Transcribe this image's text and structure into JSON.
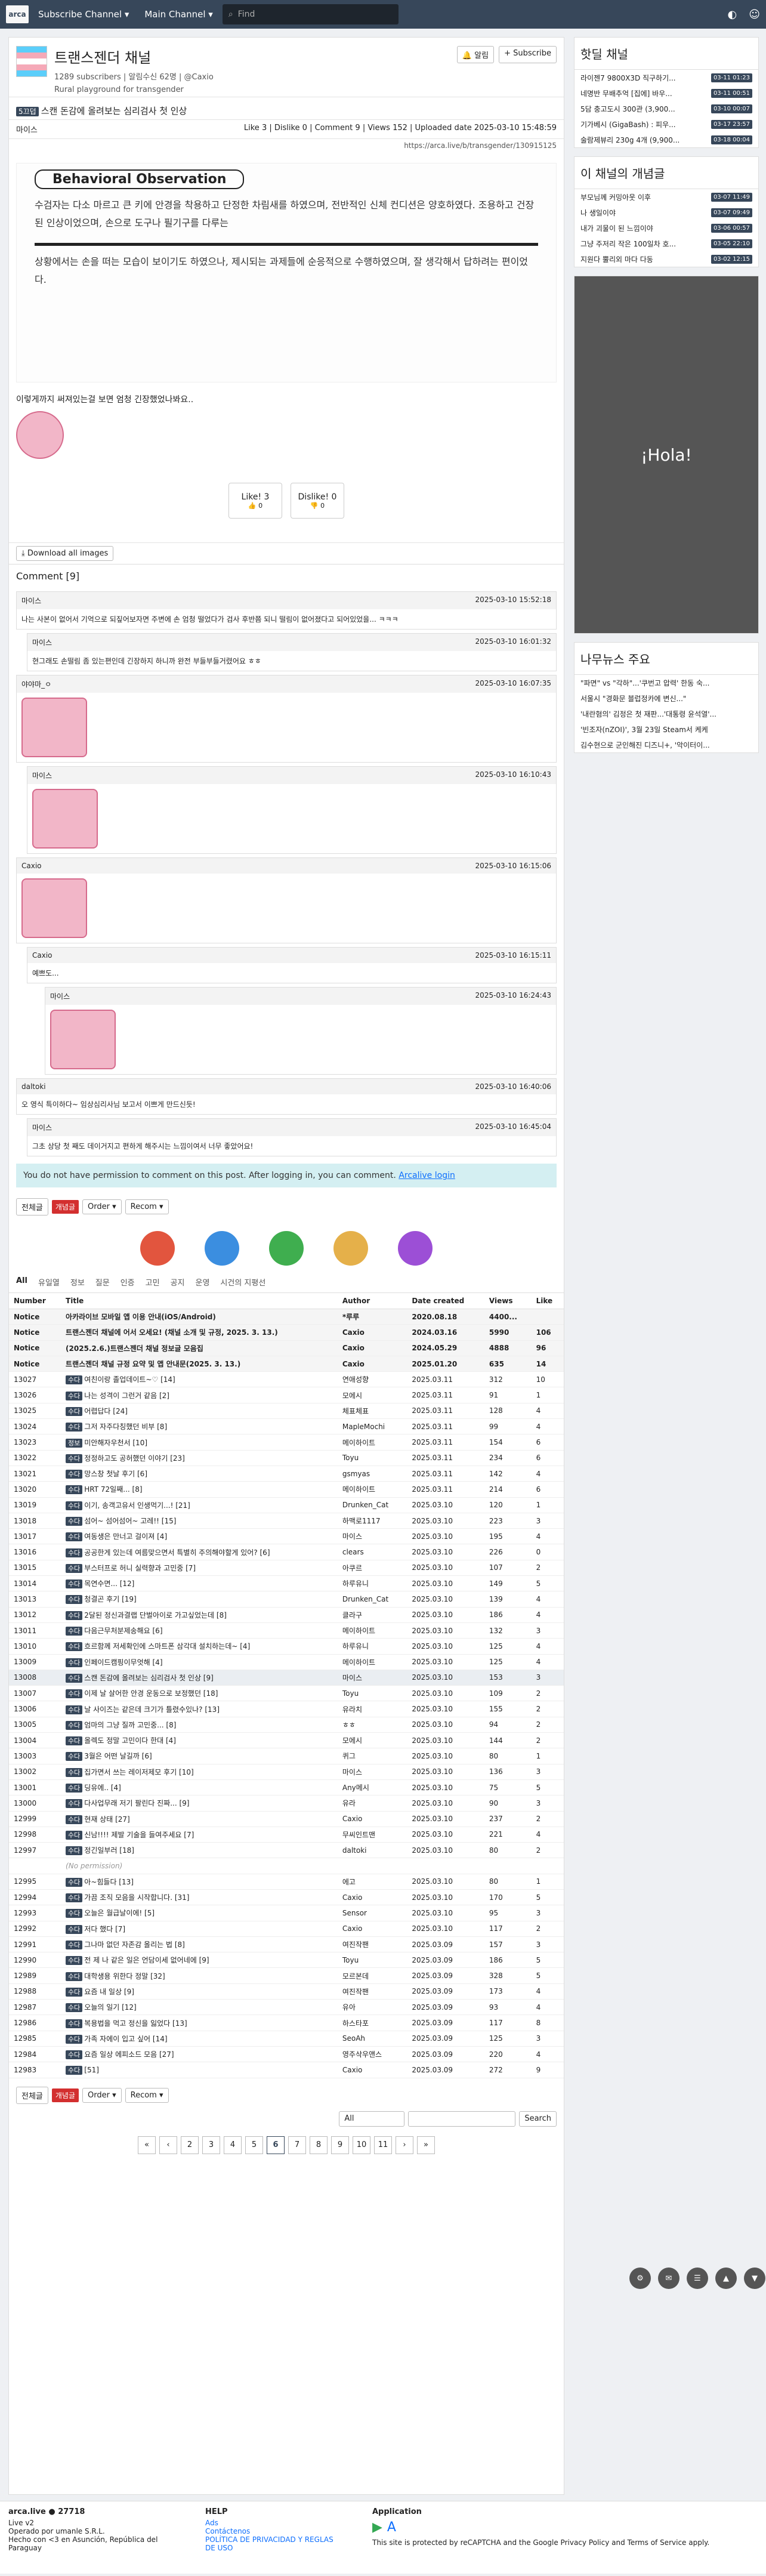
{
  "nav": {
    "subscribe": "Subscribe Channel ▾",
    "main": "Main Channel ▾",
    "search_placeholder": "Find"
  },
  "channel": {
    "title": "트랜스젠더 채널",
    "meta": "1289 subscribers | 알림수신 62명 | @Caxio",
    "desc": "Rural playground for transgender",
    "alarm": "알림",
    "subscribe": "+ Subscribe"
  },
  "post": {
    "tag": "5끄덥",
    "title": "스캔 돈감에 올려보는 심리검사 첫 인상",
    "author": "마이스",
    "stats": "Like 3 | Dislike 0 | Comment 9 | Views 152 | Uploaded date 2025-03-10 15:48:59",
    "url": "https://arca.live/b/transgender/130915125",
    "img_title": "Behavioral Observation",
    "img_p1": "수검자는 다소 마르고 큰 키에 안경을 착용하고 단정한 차림새를 하였으며, 전반적인 신체 컨디션은 양호하였다. 조용하고 건장된 인상이었으며, 손으로 도구나 필기구를 다루는",
    "img_p2": "상황에서는 손을 떠는 모습이 보이기도 하였으나, 제시되는 과제들에 순응적으로 수행하였으며, 잘 생각해서 답하려는 편이었다.",
    "body": "이렇게까지 써져있는걸 보면 엄청 긴장했었나봐요..",
    "like": "Like! 3",
    "like_sub": "0",
    "dislike": "Dislike! 0",
    "dislike_sub": "0",
    "download": "Download all images"
  },
  "comments": {
    "header": "Comment [9]",
    "items": [
      {
        "author": "마이스",
        "date": "2025-03-10 15:52:18",
        "text": "나는 사본이 없어서 기억으로 되짚어보자면 주변에 손 엄청 떨었다가 검사 후반쯤 되니 떨림이 없어졌다고 되어있었을... ㅋㅋㅋ"
      },
      {
        "author": "마이스",
        "date": "2025-03-10 16:01:32",
        "text": "현그래도 손떨림 좀 있는편인데 긴장하지 하니까 완전 부들부들거렸어요 ㅎㅎ"
      },
      {
        "author": "야야마_ㅇ",
        "date": "2025-03-10 16:07:35",
        "text": ""
      },
      {
        "author": "마이스",
        "date": "2025-03-10 16:10:43",
        "text": ""
      },
      {
        "author": "Caxio",
        "date": "2025-03-10 16:15:06",
        "text": ""
      },
      {
        "author": "Caxio",
        "date": "2025-03-10 16:15:11",
        "text": "예쁘도..."
      },
      {
        "author": "마이스",
        "date": "2025-03-10 16:24:43",
        "text": ""
      },
      {
        "author": "daltoki",
        "date": "2025-03-10 16:40:06",
        "text": "오 영식 특이하다~ 임상심리사님 보고서 이쁘게 만드신듯!"
      },
      {
        "author": "마이스",
        "date": "2025-03-10 16:45:04",
        "text": "그초 상당 첫 째도 데이거지고 편하게 해주시는 느낌이여서 너무 좋았어요!"
      }
    ]
  },
  "login_notice": "You do not have permission to comment on this post. After logging in, you can comment.",
  "login_link": "Arcalive login",
  "filters": {
    "all": "전체글",
    "hot": "개념글",
    "order": "Order ▾",
    "recom": "Recom ▾"
  },
  "tabs": [
    "All",
    "유일열",
    "정보",
    "질문",
    "인증",
    "고민",
    "공지",
    "운영",
    "시건의 지평선"
  ],
  "table": {
    "headers": [
      "Number",
      "Title",
      "Author",
      "Date created",
      "Views",
      "Like"
    ],
    "notices": [
      {
        "n": "Notice",
        "t": "아카라이브 모바일 앱 이용 안내(iOS/Android)",
        "a": "*루루",
        "d": "2020.08.18",
        "v": "4400...",
        "l": ""
      },
      {
        "n": "Notice",
        "t": "트랜스젠더 채널에 어서 오세요! (채널 소개 및 규정, 2025. 3. 13.)",
        "a": "Caxio",
        "d": "2024.03.16",
        "v": "5990",
        "l": "106"
      },
      {
        "n": "Notice",
        "t": "(2025.2.6.)트랜스젠더 채널 정보글 모음집",
        "a": "Caxio",
        "d": "2024.05.29",
        "v": "4888",
        "l": "96"
      },
      {
        "n": "Notice",
        "t": "트랜스젠더 채널 규정 요약 및 앱 안내문(2025. 3. 13.)",
        "a": "Caxio",
        "d": "2025.01.20",
        "v": "635",
        "l": "14"
      }
    ],
    "rows": [
      {
        "n": "13027",
        "c": "수다",
        "t": "여친이랑 졸업데이트~♡ [14]",
        "a": "연애성향",
        "d": "2025.03.11",
        "v": "312",
        "l": "10"
      },
      {
        "n": "13026",
        "c": "수다",
        "t": "나는 성격이 그런거 같음 [2]",
        "a": "모에시",
        "d": "2025.03.11",
        "v": "91",
        "l": "1"
      },
      {
        "n": "13025",
        "c": "수다",
        "t": "어렵답다 [24]",
        "a": "체표체표",
        "d": "2025.03.11",
        "v": "128",
        "l": "4"
      },
      {
        "n": "13024",
        "c": "수다",
        "t": "그저 자주다칭했던 비부 [8]",
        "a": "MapleMochi",
        "d": "2025.03.11",
        "v": "99",
        "l": "4"
      },
      {
        "n": "13023",
        "c": "정보",
        "t": "미안해자우천서 [10]",
        "a": "메이하이트",
        "d": "2025.03.11",
        "v": "154",
        "l": "6"
      },
      {
        "n": "13022",
        "c": "수다",
        "t": "정정하고도 공허했던 이야기 [23]",
        "a": "Toyu",
        "d": "2025.03.11",
        "v": "234",
        "l": "6"
      },
      {
        "n": "13021",
        "c": "수다",
        "t": "망스창 첫날 후기 [6]",
        "a": "gsmyas",
        "d": "2025.03.11",
        "v": "142",
        "l": "4"
      },
      {
        "n": "13020",
        "c": "수다",
        "t": "HRT 72일째... [8]",
        "a": "메이하이트",
        "d": "2025.03.11",
        "v": "214",
        "l": "6"
      },
      {
        "n": "13019",
        "c": "수다",
        "t": "이기, 송객고유서 인생먹기...! [21]",
        "a": "Drunken_Cat",
        "d": "2025.03.10",
        "v": "120",
        "l": "1"
      },
      {
        "n": "13018",
        "c": "수다",
        "t": "섬어~ 섬어섬어~ 고레!! [15]",
        "a": "하맥로1117",
        "d": "2025.03.10",
        "v": "223",
        "l": "3"
      },
      {
        "n": "13017",
        "c": "수다",
        "t": "여동생은 만너고 걸이져 [4]",
        "a": "마이스",
        "d": "2025.03.10",
        "v": "195",
        "l": "4"
      },
      {
        "n": "13016",
        "c": "수다",
        "t": "공공한게 있는데 여름맞으면서 특별히 주의해야할게 있어? [6]",
        "a": "clears",
        "d": "2025.03.10",
        "v": "226",
        "l": "0"
      },
      {
        "n": "13015",
        "c": "수다",
        "t": "부스터프로 허니 실력향과 고민중 [7]",
        "a": "아쿠르",
        "d": "2025.03.10",
        "v": "107",
        "l": "2"
      },
      {
        "n": "13014",
        "c": "수다",
        "t": "목연수면... [12]",
        "a": "하루유니",
        "d": "2025.03.10",
        "v": "149",
        "l": "5"
      },
      {
        "n": "13013",
        "c": "수다",
        "t": "청결곤 후기 [19]",
        "a": "Drunken_Cat",
        "d": "2025.03.10",
        "v": "139",
        "l": "4"
      },
      {
        "n": "13012",
        "c": "수다",
        "t": "2달된 정신과결랩 단벌아이로 가고싶었는데 [8]",
        "a": "클라구",
        "d": "2025.03.10",
        "v": "186",
        "l": "4"
      },
      {
        "n": "13011",
        "c": "수다",
        "t": "다음근무처분제송해요 [6]",
        "a": "메이하이트",
        "d": "2025.03.10",
        "v": "132",
        "l": "3"
      },
      {
        "n": "13010",
        "c": "수다",
        "t": "흐르함께 저세확인에 스마트폰 삼각대 설치하는데~ [4]",
        "a": "하루유니",
        "d": "2025.03.10",
        "v": "125",
        "l": "4"
      },
      {
        "n": "13009",
        "c": "수다",
        "t": "인페이드캠핑이무엇해 [4]",
        "a": "메이하이트",
        "d": "2025.03.10",
        "v": "125",
        "l": "4"
      },
      {
        "n": "13008",
        "c": "수다",
        "t": "스캔 돈감에 올려보는 심리검사 첫 인상 [9]",
        "a": "마이스",
        "d": "2025.03.10",
        "v": "153",
        "l": "3"
      },
      {
        "n": "13007",
        "c": "수다",
        "t": "이제 날 살어한 안경 운동으로 보정했던 [18]",
        "a": "Toyu",
        "d": "2025.03.10",
        "v": "109",
        "l": "2"
      },
      {
        "n": "13006",
        "c": "수다",
        "t": "날 사이즈는 같은데 크기가 틀렸수있나? [13]",
        "a": "유라치",
        "d": "2025.03.10",
        "v": "155",
        "l": "2"
      },
      {
        "n": "13005",
        "c": "수다",
        "t": "엄마의 그냥 질까 고민중... [8]",
        "a": "ㅎㅎ",
        "d": "2025.03.10",
        "v": "94",
        "l": "2"
      },
      {
        "n": "13004",
        "c": "수다",
        "t": "올렉도 정말 고민이다 한대 [4]",
        "a": "모에시",
        "d": "2025.03.10",
        "v": "144",
        "l": "2"
      },
      {
        "n": "13003",
        "c": "수다",
        "t": "3월은 어떤 날길까 [6]",
        "a": "퀴그",
        "d": "2025.03.10",
        "v": "80",
        "l": "1"
      },
      {
        "n": "13002",
        "c": "수다",
        "t": "집가면서 쓰는 레이저제모 후기 [10]",
        "a": "마이스",
        "d": "2025.03.10",
        "v": "136",
        "l": "3"
      },
      {
        "n": "13001",
        "c": "수다",
        "t": "딩유에.. [4]",
        "a": "Any메시",
        "d": "2025.03.10",
        "v": "75",
        "l": "5"
      },
      {
        "n": "13000",
        "c": "수다",
        "t": "다사업무래 저기 팔린다 진짜... [9]",
        "a": "유라",
        "d": "2025.03.10",
        "v": "90",
        "l": "3"
      },
      {
        "n": "12999",
        "c": "수다",
        "t": "현재 상태 [27]",
        "a": "Caxio",
        "d": "2025.03.10",
        "v": "237",
        "l": "2"
      },
      {
        "n": "12998",
        "c": "수다",
        "t": "신남!!!! 제발 기술을 들여주세요 [7]",
        "a": "무씨인트맨",
        "d": "2025.03.10",
        "v": "221",
        "l": "4"
      },
      {
        "n": "12997",
        "c": "수다",
        "t": "정긴일부러 [18]",
        "a": "daltoki",
        "d": "2025.03.10",
        "v": "80",
        "l": "2"
      },
      {
        "n": "",
        "c": "",
        "t": "(No permission)",
        "a": "",
        "d": "",
        "v": "",
        "l": ""
      },
      {
        "n": "12995",
        "c": "수다",
        "t": "아~힘들다 [13]",
        "a": "에고",
        "d": "2025.03.10",
        "v": "80",
        "l": "1"
      },
      {
        "n": "12994",
        "c": "수다",
        "t": "가끔 조직 모음을 시작합니다. [31]",
        "a": "Caxio",
        "d": "2025.03.10",
        "v": "170",
        "l": "5"
      },
      {
        "n": "12993",
        "c": "수다",
        "t": "오늘은 월급날이에! [5]",
        "a": "Sensor",
        "d": "2025.03.10",
        "v": "95",
        "l": "3"
      },
      {
        "n": "12992",
        "c": "수다",
        "t": "저다 했다 [7]",
        "a": "Caxio",
        "d": "2025.03.10",
        "v": "117",
        "l": "2"
      },
      {
        "n": "12991",
        "c": "수다",
        "t": "그나마 없던 자존감 올리는 법 [8]",
        "a": "여진작팬",
        "d": "2025.03.09",
        "v": "157",
        "l": "3"
      },
      {
        "n": "12990",
        "c": "수다",
        "t": "전 제 나 같은 일은 언담이세 없어네에 [9]",
        "a": "Toyu",
        "d": "2025.03.09",
        "v": "186",
        "l": "5"
      },
      {
        "n": "12989",
        "c": "수다",
        "t": "대학생용 위한다 정말 [32]",
        "a": "모르본데",
        "d": "2025.03.09",
        "v": "328",
        "l": "5"
      },
      {
        "n": "12988",
        "c": "수다",
        "t": "요즘 내 일상 [9]",
        "a": "여진작팬",
        "d": "2025.03.09",
        "v": "173",
        "l": "4"
      },
      {
        "n": "12987",
        "c": "수다",
        "t": "오늘의 일기 [12]",
        "a": "유아",
        "d": "2025.03.09",
        "v": "93",
        "l": "4"
      },
      {
        "n": "12986",
        "c": "수다",
        "t": "복용법을 먹고 정신을 잃었다 [13]",
        "a": "하스타포",
        "d": "2025.03.09",
        "v": "117",
        "l": "8"
      },
      {
        "n": "12985",
        "c": "수다",
        "t": "가족 자에이 입고 싶어 [14]",
        "a": "SeoAh",
        "d": "2025.03.09",
        "v": "125",
        "l": "3"
      },
      {
        "n": "12984",
        "c": "수다",
        "t": "요즘 일상 에피소드 모음 [27]",
        "a": "영주삭우앤스",
        "d": "2025.03.09",
        "v": "220",
        "l": "4"
      },
      {
        "n": "12983",
        "c": "수다",
        "t": "[51]",
        "a": "Caxio",
        "d": "2025.03.09",
        "v": "272",
        "l": "9"
      }
    ]
  },
  "search": {
    "select": "All",
    "button": "Search"
  },
  "pages": [
    "«",
    "‹",
    "2",
    "3",
    "4",
    "5",
    "6",
    "7",
    "8",
    "9",
    "10",
    "11",
    "›",
    "»"
  ],
  "current_page": "6",
  "sidebar": {
    "hot_title": "핫딜 채널",
    "hot": [
      {
        "t": "라이젠7 9800X3D 직구하기...",
        "d": "03-11 01:23"
      },
      {
        "t": "네명반 무배추억 [집에] 바우...",
        "d": "03-11 00:51"
      },
      {
        "t": "5담 충고도시 300관 (3,900...",
        "d": "03-10 00:07"
      },
      {
        "t": "기가베시 (GigaBash) : 피우...",
        "d": "03-17 23:57"
      },
      {
        "t": "술람제뷰리 230g 4개 (9,900...",
        "d": "03-18 00:04"
      }
    ],
    "concept_title": "이 채널의 개념글",
    "concept": [
      {
        "t": "부모님께 커밍아웃 이후",
        "d": "03-07 11:49"
      },
      {
        "t": "나 생일이야",
        "d": "03-07 09:49"
      },
      {
        "t": "내가 괴물이 된 느낌이야",
        "d": "03-06 00:57"
      },
      {
        "t": "그냥 주저리 작은 100일차 호...",
        "d": "03-05 22:10"
      },
      {
        "t": "지원다 뿔리외 마다 다동",
        "d": "03-02 12:15"
      }
    ],
    "ad": "¡Hola!",
    "news_title": "나무뉴스 주요",
    "news": [
      "\"파면\" vs \"각하\"...'쿠번고 압력' 한동 숙...",
      "서울시 \"경화문 블럽정카에 변신...\"",
      "'내란혐의' 김정은 첫 재판...'대통령 윤석열'...",
      "'빈조자(nZOI)', 3월 23일 Steam서 케케",
      "김수현으로 군인해진 디즈니+, '악이터이..."
    ]
  },
  "footer": {
    "brand": "arca.live",
    "count": "27718",
    "version": "Live v2",
    "operator": "Operado por umanle S.R.L.",
    "made": "Hecho con <3 en Asunción, República del Paraguay",
    "help": "HELP",
    "ads": "Ads",
    "contact": "Contáctenos",
    "policy": "POLÍTICA DE PRIVACIDAD Y REGLAS DE USO",
    "app": "Application",
    "recaptcha": "This site is protected by reCAPTCHA and the Google Privacy Policy and Terms of Service apply."
  }
}
